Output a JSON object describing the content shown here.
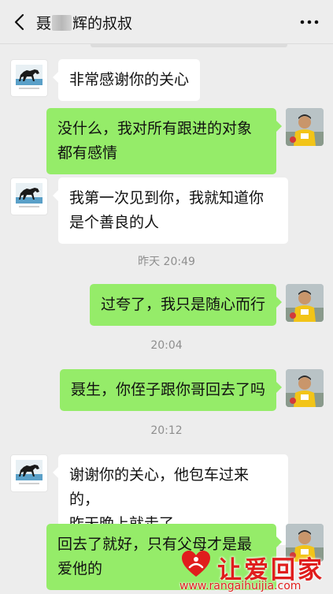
{
  "header": {
    "title_prefix": "聂",
    "title_suffix": "辉的叔叔",
    "back_icon": "chevron-left-icon",
    "more_icon": "more-dots-icon"
  },
  "messages": [
    {
      "side": "left",
      "text": "非常感谢你的关心"
    },
    {
      "side": "right",
      "lines": [
        "没什么，我对所有跟进的对象",
        "都有感情"
      ]
    },
    {
      "side": "left",
      "lines": [
        "我第一次见到你，我就知道你",
        "是个善良的人"
      ]
    },
    {
      "time": "昨天 20:49"
    },
    {
      "side": "right",
      "text": "过夸了，我只是随心而行"
    },
    {
      "time": "20:04"
    },
    {
      "side": "right",
      "text": "聂生，你侄子跟你哥回去了吗"
    },
    {
      "time": "20:12"
    },
    {
      "side": "left",
      "lines": [
        "谢谢你的关心，他包车过来的，",
        "昨天晚上就走了"
      ]
    },
    {
      "side": "right",
      "lines": [
        "回去了就好，只有父母才是最",
        "爱他的"
      ]
    }
  ],
  "watermark": {
    "text": "让爱回家",
    "url": "www.rangaihuijia.com"
  },
  "colors": {
    "background": "#ededed",
    "sent_bubble": "#95ec69",
    "received_bubble": "#ffffff",
    "watermark": "#e01d1d"
  }
}
